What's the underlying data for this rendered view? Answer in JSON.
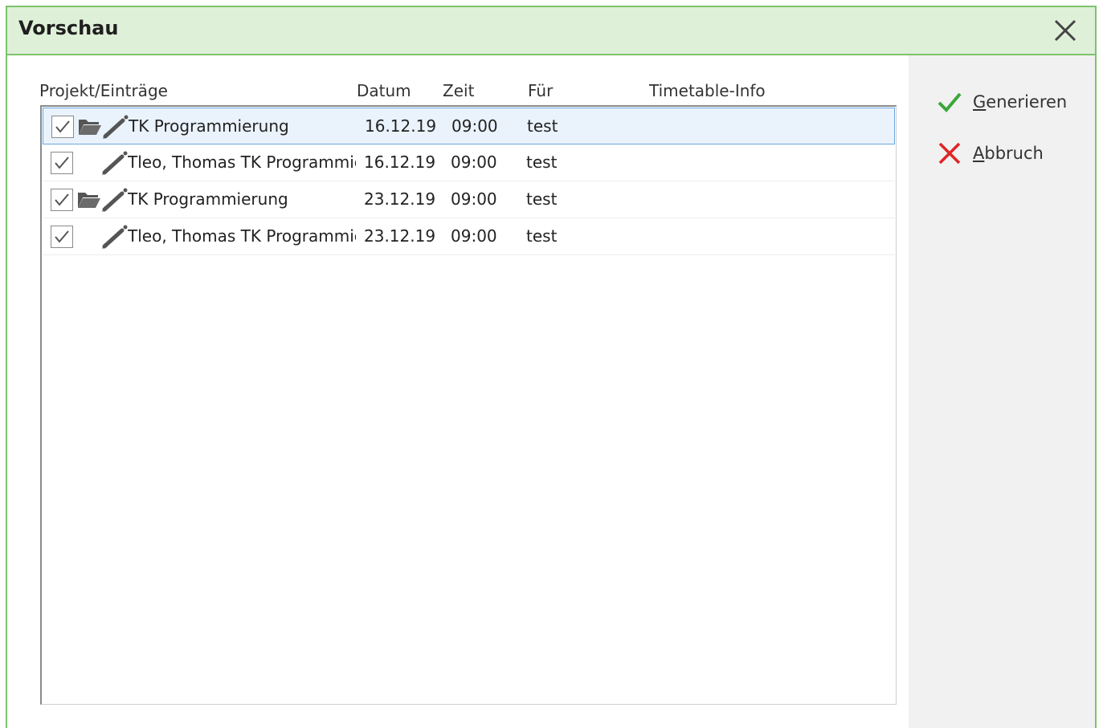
{
  "window": {
    "title": "Vorschau"
  },
  "columns": {
    "project": "Projekt/Einträge",
    "date": "Datum",
    "time": "Zeit",
    "for": "Für",
    "info": "Timetable-Info"
  },
  "rows": [
    {
      "name": "TK Programmierung",
      "date": "16.12.19",
      "time": "09:00",
      "for": "test",
      "info": "",
      "checked": true,
      "folder": true,
      "selected": true
    },
    {
      "name": "Tleo, Thomas TK Programmierung",
      "date": "16.12.19",
      "time": "09:00",
      "for": "test",
      "info": "",
      "checked": true,
      "folder": false,
      "selected": false
    },
    {
      "name": "TK Programmierung",
      "date": "23.12.19",
      "time": "09:00",
      "for": "test",
      "info": "",
      "checked": true,
      "folder": true,
      "selected": false
    },
    {
      "name": "Tleo, Thomas TK Programmierung",
      "date": "23.12.19",
      "time": "09:00",
      "for": "test",
      "info": "",
      "checked": true,
      "folder": false,
      "selected": false
    }
  ],
  "actions": {
    "generate": {
      "mnemonic": "G",
      "rest": "enerieren",
      "icon": "checkmark-icon",
      "color": "#3aa63a"
    },
    "cancel": {
      "mnemonic": "A",
      "rest": "bbruch",
      "icon": "x-icon",
      "color": "#e02424"
    }
  },
  "colors": {
    "accent": "#7cc36a",
    "titlebar": "#dff0d8",
    "selection": "#6aa6e0"
  }
}
